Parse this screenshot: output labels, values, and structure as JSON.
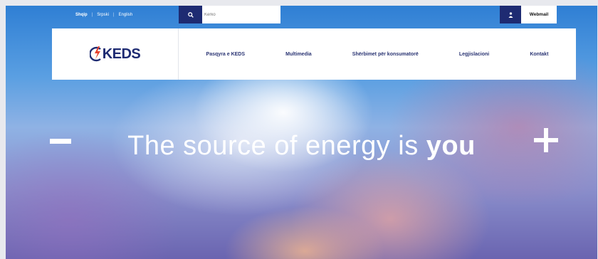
{
  "top_bar": {
    "languages": [
      {
        "label": "Shqip",
        "active": true
      },
      {
        "label": "Srpski",
        "active": false
      },
      {
        "label": "English",
        "active": false
      }
    ],
    "language_separator": "|",
    "search": {
      "value": "",
      "placeholder": "Kerko",
      "icon": "search-icon"
    },
    "user_icon": "user-icon",
    "webmail_label": "Webmail"
  },
  "nav": {
    "logo_text": "KEDS",
    "items": [
      {
        "label": "Pasqyra e KEDS"
      },
      {
        "label": "Multimedia"
      },
      {
        "label": "Shërbimet për konsumatorë"
      },
      {
        "label": "Legjislacioni"
      },
      {
        "label": "Kontakt"
      }
    ]
  },
  "hero": {
    "title_main": "The source of energy is ",
    "title_emphasis": "you",
    "prev_symbol": "minus",
    "next_symbol": "plus"
  },
  "colors": {
    "brand_navy": "#1e2b72",
    "logo_accent": "#e7432e",
    "nav_background": "#ffffff",
    "hero_text": "#ffffff"
  }
}
